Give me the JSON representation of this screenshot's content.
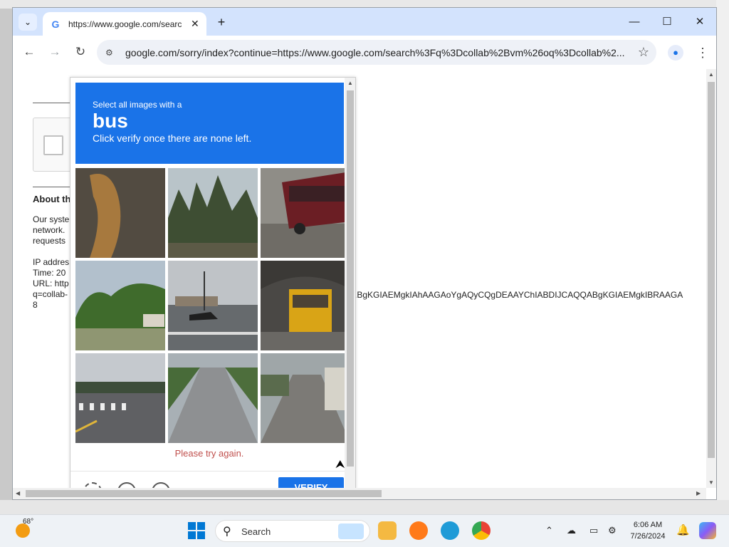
{
  "browser": {
    "tab_title": "https://www.google.com/searc",
    "url": "google.com/sorry/index?continue=https://www.google.com/search%3Fq%3Dcollab%2Bvm%26oq%3Dcollab%2..."
  },
  "page": {
    "about_heading": "About th",
    "text_lines": [
      "Our syste",
      "network.",
      "requests"
    ],
    "info_lines": [
      "IP addres",
      "Time: 20",
      "URL: http",
      "q=collab-",
      "8"
    ],
    "long_url_fragment": ".BgKGIAEMgkIAhAAGAoYgAQyCQgDEAAYChIABDIJCAQQABgKGIAEMgkIBRAAGA"
  },
  "captcha": {
    "prompt_small": "Select all images with a",
    "prompt_object": "bus",
    "prompt_sub": "Click verify once there are none left.",
    "error_text": "Please try again.",
    "verify_label": "VERIFY",
    "tiles": [
      {
        "subject": "blurry-tan-object"
      },
      {
        "subject": "trees"
      },
      {
        "subject": "red-bus"
      },
      {
        "subject": "roadside-trees"
      },
      {
        "subject": "intersection-car"
      },
      {
        "subject": "yellow-school-bus"
      },
      {
        "subject": "crosswalk"
      },
      {
        "subject": "street"
      },
      {
        "subject": "street-bus"
      }
    ]
  },
  "taskbar": {
    "weather_temp": "68°",
    "search_placeholder": "Search",
    "time": "6:06 AM",
    "date": "7/26/2024"
  }
}
